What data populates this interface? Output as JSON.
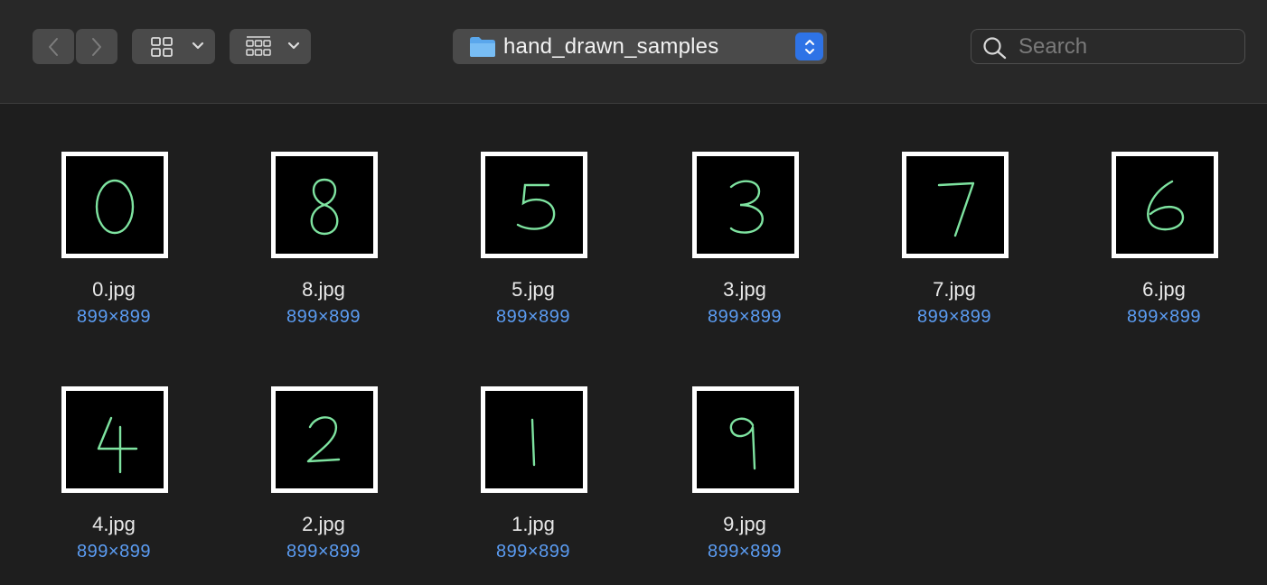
{
  "toolbar": {
    "folder_title": "hand_drawn_samples",
    "search_placeholder": "Search"
  },
  "colors": {
    "dims_text": "#5b9cf2",
    "digit_stroke": "#7ee3a0",
    "stepper": "#2e73e6",
    "folder": "#6cb4f0"
  },
  "files": [
    {
      "name": "0.jpg",
      "dims": "899×899",
      "digit": "0"
    },
    {
      "name": "8.jpg",
      "dims": "899×899",
      "digit": "8"
    },
    {
      "name": "5.jpg",
      "dims": "899×899",
      "digit": "5"
    },
    {
      "name": "3.jpg",
      "dims": "899×899",
      "digit": "3"
    },
    {
      "name": "7.jpg",
      "dims": "899×899",
      "digit": "7"
    },
    {
      "name": "6.jpg",
      "dims": "899×899",
      "digit": "6"
    },
    {
      "name": "4.jpg",
      "dims": "899×899",
      "digit": "4"
    },
    {
      "name": "2.jpg",
      "dims": "899×899",
      "digit": "2"
    },
    {
      "name": "1.jpg",
      "dims": "899×899",
      "digit": "1"
    },
    {
      "name": "9.jpg",
      "dims": "899×899",
      "digit": "9"
    }
  ]
}
